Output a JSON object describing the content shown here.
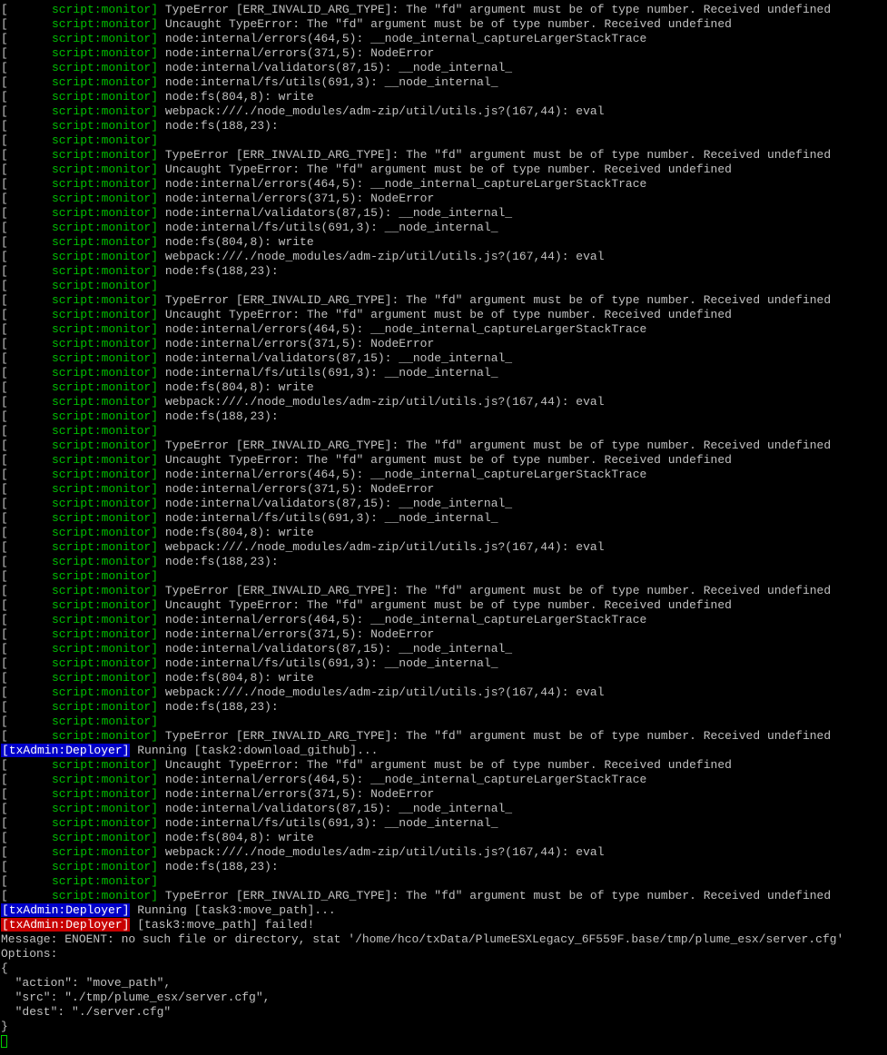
{
  "colors": {
    "background": "#000000",
    "text": "#c0c0c0",
    "monitor_tag": "#00c000",
    "deployer_running_bg": "#0000c8",
    "deployer_failed_bg": "#c80000",
    "cursor": "#00d000"
  },
  "terminal": {
    "cursor": "cursor",
    "lines": [
      {
        "type": "monitor",
        "bracket": "[",
        "tag": "script:monitor]",
        "text": " TypeError [ERR_INVALID_ARG_TYPE]: The \"fd\" argument must be of type number. Received undefined"
      },
      {
        "type": "monitor",
        "bracket": "[",
        "tag": "script:monitor]",
        "text": " Uncaught TypeError: The \"fd\" argument must be of type number. Received undefined"
      },
      {
        "type": "monitor",
        "bracket": "[",
        "tag": "script:monitor]",
        "text": " node:internal/errors(464,5): __node_internal_captureLargerStackTrace"
      },
      {
        "type": "monitor",
        "bracket": "[",
        "tag": "script:monitor]",
        "text": " node:internal/errors(371,5): NodeError"
      },
      {
        "type": "monitor",
        "bracket": "[",
        "tag": "script:monitor]",
        "text": " node:internal/validators(87,15): __node_internal_"
      },
      {
        "type": "monitor",
        "bracket": "[",
        "tag": "script:monitor]",
        "text": " node:internal/fs/utils(691,3): __node_internal_"
      },
      {
        "type": "monitor",
        "bracket": "[",
        "tag": "script:monitor]",
        "text": " node:fs(804,8): write"
      },
      {
        "type": "monitor",
        "bracket": "[",
        "tag": "script:monitor]",
        "text": " webpack:///./node_modules/adm-zip/util/utils.js?(167,44): eval"
      },
      {
        "type": "monitor",
        "bracket": "[",
        "tag": "script:monitor]",
        "text": " node:fs(188,23):"
      },
      {
        "type": "monitor",
        "bracket": "[",
        "tag": "script:monitor]",
        "text": ""
      },
      {
        "type": "monitor",
        "bracket": "[",
        "tag": "script:monitor]",
        "text": " TypeError [ERR_INVALID_ARG_TYPE]: The \"fd\" argument must be of type number. Received undefined"
      },
      {
        "type": "monitor",
        "bracket": "[",
        "tag": "script:monitor]",
        "text": " Uncaught TypeError: The \"fd\" argument must be of type number. Received undefined"
      },
      {
        "type": "monitor",
        "bracket": "[",
        "tag": "script:monitor]",
        "text": " node:internal/errors(464,5): __node_internal_captureLargerStackTrace"
      },
      {
        "type": "monitor",
        "bracket": "[",
        "tag": "script:monitor]",
        "text": " node:internal/errors(371,5): NodeError"
      },
      {
        "type": "monitor",
        "bracket": "[",
        "tag": "script:monitor]",
        "text": " node:internal/validators(87,15): __node_internal_"
      },
      {
        "type": "monitor",
        "bracket": "[",
        "tag": "script:monitor]",
        "text": " node:internal/fs/utils(691,3): __node_internal_"
      },
      {
        "type": "monitor",
        "bracket": "[",
        "tag": "script:monitor]",
        "text": " node:fs(804,8): write"
      },
      {
        "type": "monitor",
        "bracket": "[",
        "tag": "script:monitor]",
        "text": " webpack:///./node_modules/adm-zip/util/utils.js?(167,44): eval"
      },
      {
        "type": "monitor",
        "bracket": "[",
        "tag": "script:monitor]",
        "text": " node:fs(188,23):"
      },
      {
        "type": "monitor",
        "bracket": "[",
        "tag": "script:monitor]",
        "text": ""
      },
      {
        "type": "monitor",
        "bracket": "[",
        "tag": "script:monitor]",
        "text": " TypeError [ERR_INVALID_ARG_TYPE]: The \"fd\" argument must be of type number. Received undefined"
      },
      {
        "type": "monitor",
        "bracket": "[",
        "tag": "script:monitor]",
        "text": " Uncaught TypeError: The \"fd\" argument must be of type number. Received undefined"
      },
      {
        "type": "monitor",
        "bracket": "[",
        "tag": "script:monitor]",
        "text": " node:internal/errors(464,5): __node_internal_captureLargerStackTrace"
      },
      {
        "type": "monitor",
        "bracket": "[",
        "tag": "script:monitor]",
        "text": " node:internal/errors(371,5): NodeError"
      },
      {
        "type": "monitor",
        "bracket": "[",
        "tag": "script:monitor]",
        "text": " node:internal/validators(87,15): __node_internal_"
      },
      {
        "type": "monitor",
        "bracket": "[",
        "tag": "script:monitor]",
        "text": " node:internal/fs/utils(691,3): __node_internal_"
      },
      {
        "type": "monitor",
        "bracket": "[",
        "tag": "script:monitor]",
        "text": " node:fs(804,8): write"
      },
      {
        "type": "monitor",
        "bracket": "[",
        "tag": "script:monitor]",
        "text": " webpack:///./node_modules/adm-zip/util/utils.js?(167,44): eval"
      },
      {
        "type": "monitor",
        "bracket": "[",
        "tag": "script:monitor]",
        "text": " node:fs(188,23):"
      },
      {
        "type": "monitor",
        "bracket": "[",
        "tag": "script:monitor]",
        "text": ""
      },
      {
        "type": "monitor",
        "bracket": "[",
        "tag": "script:monitor]",
        "text": " TypeError [ERR_INVALID_ARG_TYPE]: The \"fd\" argument must be of type number. Received undefined"
      },
      {
        "type": "monitor",
        "bracket": "[",
        "tag": "script:monitor]",
        "text": " Uncaught TypeError: The \"fd\" argument must be of type number. Received undefined"
      },
      {
        "type": "monitor",
        "bracket": "[",
        "tag": "script:monitor]",
        "text": " node:internal/errors(464,5): __node_internal_captureLargerStackTrace"
      },
      {
        "type": "monitor",
        "bracket": "[",
        "tag": "script:monitor]",
        "text": " node:internal/errors(371,5): NodeError"
      },
      {
        "type": "monitor",
        "bracket": "[",
        "tag": "script:monitor]",
        "text": " node:internal/validators(87,15): __node_internal_"
      },
      {
        "type": "monitor",
        "bracket": "[",
        "tag": "script:monitor]",
        "text": " node:internal/fs/utils(691,3): __node_internal_"
      },
      {
        "type": "monitor",
        "bracket": "[",
        "tag": "script:monitor]",
        "text": " node:fs(804,8): write"
      },
      {
        "type": "monitor",
        "bracket": "[",
        "tag": "script:monitor]",
        "text": " webpack:///./node_modules/adm-zip/util/utils.js?(167,44): eval"
      },
      {
        "type": "monitor",
        "bracket": "[",
        "tag": "script:monitor]",
        "text": " node:fs(188,23):"
      },
      {
        "type": "monitor",
        "bracket": "[",
        "tag": "script:monitor]",
        "text": ""
      },
      {
        "type": "monitor",
        "bracket": "[",
        "tag": "script:monitor]",
        "text": " TypeError [ERR_INVALID_ARG_TYPE]: The \"fd\" argument must be of type number. Received undefined"
      },
      {
        "type": "monitor",
        "bracket": "[",
        "tag": "script:monitor]",
        "text": " Uncaught TypeError: The \"fd\" argument must be of type number. Received undefined"
      },
      {
        "type": "monitor",
        "bracket": "[",
        "tag": "script:monitor]",
        "text": " node:internal/errors(464,5): __node_internal_captureLargerStackTrace"
      },
      {
        "type": "monitor",
        "bracket": "[",
        "tag": "script:monitor]",
        "text": " node:internal/errors(371,5): NodeError"
      },
      {
        "type": "monitor",
        "bracket": "[",
        "tag": "script:monitor]",
        "text": " node:internal/validators(87,15): __node_internal_"
      },
      {
        "type": "monitor",
        "bracket": "[",
        "tag": "script:monitor]",
        "text": " node:internal/fs/utils(691,3): __node_internal_"
      },
      {
        "type": "monitor",
        "bracket": "[",
        "tag": "script:monitor]",
        "text": " node:fs(804,8): write"
      },
      {
        "type": "monitor",
        "bracket": "[",
        "tag": "script:monitor]",
        "text": " webpack:///./node_modules/adm-zip/util/utils.js?(167,44): eval"
      },
      {
        "type": "monitor",
        "bracket": "[",
        "tag": "script:monitor]",
        "text": " node:fs(188,23):"
      },
      {
        "type": "monitor",
        "bracket": "[",
        "tag": "script:monitor]",
        "text": ""
      },
      {
        "type": "monitor",
        "bracket": "[",
        "tag": "script:monitor]",
        "text": " TypeError [ERR_INVALID_ARG_TYPE]: The \"fd\" argument must be of type number. Received undefined"
      },
      {
        "type": "deployer",
        "color": "blue",
        "badge": "[txAdmin:Deployer]",
        "text": " Running [task2:download_github]..."
      },
      {
        "type": "monitor",
        "bracket": "[",
        "tag": "script:monitor]",
        "text": " Uncaught TypeError: The \"fd\" argument must be of type number. Received undefined"
      },
      {
        "type": "monitor",
        "bracket": "[",
        "tag": "script:monitor]",
        "text": " node:internal/errors(464,5): __node_internal_captureLargerStackTrace"
      },
      {
        "type": "monitor",
        "bracket": "[",
        "tag": "script:monitor]",
        "text": " node:internal/errors(371,5): NodeError"
      },
      {
        "type": "monitor",
        "bracket": "[",
        "tag": "script:monitor]",
        "text": " node:internal/validators(87,15): __node_internal_"
      },
      {
        "type": "monitor",
        "bracket": "[",
        "tag": "script:monitor]",
        "text": " node:internal/fs/utils(691,3): __node_internal_"
      },
      {
        "type": "monitor",
        "bracket": "[",
        "tag": "script:monitor]",
        "text": " node:fs(804,8): write"
      },
      {
        "type": "monitor",
        "bracket": "[",
        "tag": "script:monitor]",
        "text": " webpack:///./node_modules/adm-zip/util/utils.js?(167,44): eval"
      },
      {
        "type": "monitor",
        "bracket": "[",
        "tag": "script:monitor]",
        "text": " node:fs(188,23):"
      },
      {
        "type": "monitor",
        "bracket": "[",
        "tag": "script:monitor]",
        "text": ""
      },
      {
        "type": "monitor",
        "bracket": "[",
        "tag": "script:monitor]",
        "text": " TypeError [ERR_INVALID_ARG_TYPE]: The \"fd\" argument must be of type number. Received undefined"
      },
      {
        "type": "deployer",
        "color": "blue",
        "badge": "[txAdmin:Deployer]",
        "text": " Running [task3:move_path]..."
      },
      {
        "type": "deployer",
        "color": "red",
        "badge": "[txAdmin:Deployer]",
        "text": " [task3:move_path] failed!"
      },
      {
        "type": "plain",
        "text": "Message: ENOENT: no such file or directory, stat '/home/hco/txData/PlumeESXLegacy_6F559F.base/tmp/plume_esx/server.cfg'"
      },
      {
        "type": "plain",
        "text": "Options:"
      },
      {
        "type": "plain",
        "text": "{"
      },
      {
        "type": "plain",
        "text": "  \"action\": \"move_path\","
      },
      {
        "type": "plain",
        "text": "  \"src\": \"./tmp/plume_esx/server.cfg\","
      },
      {
        "type": "plain",
        "text": "  \"dest\": \"./server.cfg\""
      },
      {
        "type": "plain",
        "text": "}"
      },
      {
        "type": "cursor"
      }
    ]
  }
}
